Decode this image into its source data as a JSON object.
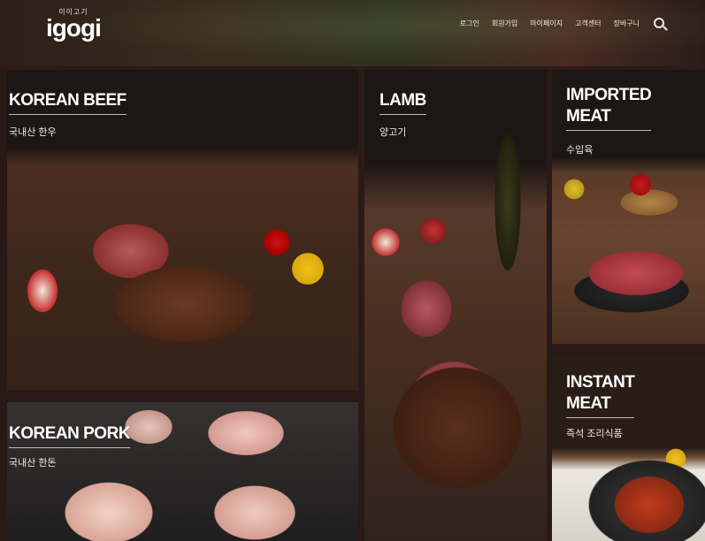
{
  "header": {
    "logo_sub": "이이고기",
    "logo_main": "igogi",
    "nav": [
      {
        "label": "로그인"
      },
      {
        "label": "회원가입"
      },
      {
        "label": "마이페이지"
      },
      {
        "label": "고객센터"
      },
      {
        "label": "장바구니"
      }
    ],
    "search_icon": "search-icon"
  },
  "tiles": {
    "korean_beef": {
      "title": "KOREAN BEEF",
      "subtitle": "국내산 한우"
    },
    "lamb": {
      "title": "LAMB",
      "subtitle": "양고기"
    },
    "imported_meat": {
      "title": "IMPORTED\nMEAT",
      "subtitle": "수입육"
    },
    "instant_meat": {
      "title": "INSTANT\nMEAT",
      "subtitle": "즉석 조리식품"
    },
    "korean_pork": {
      "title": "KOREAN PORK",
      "subtitle": "국내산 한돈"
    }
  },
  "colors": {
    "background": "#2a1a17",
    "text": "#ffffff"
  }
}
